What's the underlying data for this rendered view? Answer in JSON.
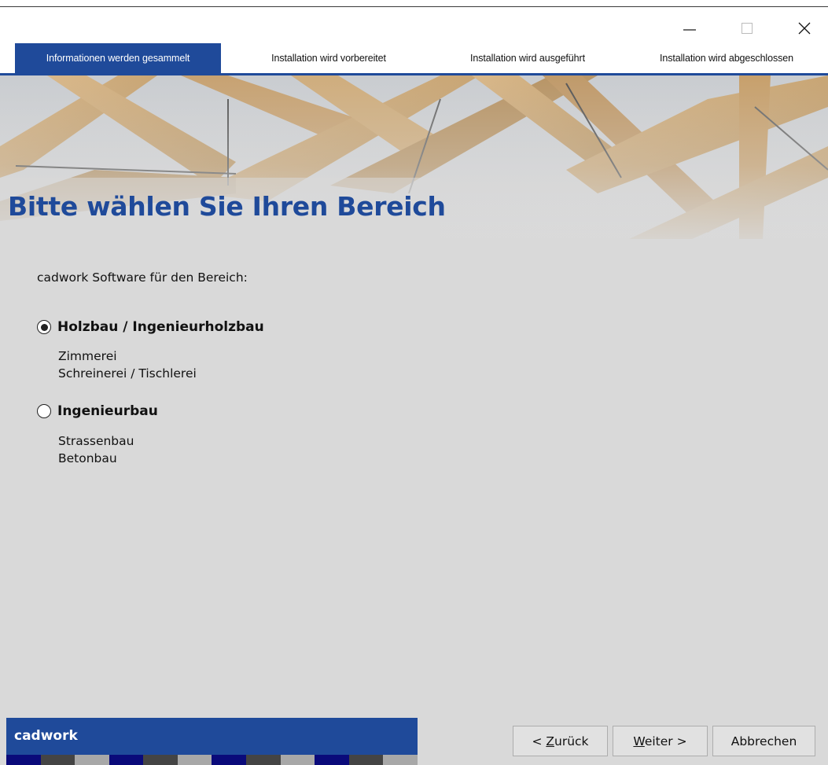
{
  "window": {
    "controls": {
      "minimize_icon": "minimize-icon",
      "maximize_icon": "maximize-icon",
      "close_icon": "close-icon"
    }
  },
  "steps": [
    {
      "label": "Informationen werden gesammelt",
      "active": true
    },
    {
      "label": "Installation wird vorbereitet",
      "active": false
    },
    {
      "label": "Installation wird ausgeführt",
      "active": false
    },
    {
      "label": "Installation wird abgeschlossen",
      "active": false
    }
  ],
  "page": {
    "title": "Bitte wählen Sie Ihren Bereich",
    "intro": "cadwork Software für den Bereich:"
  },
  "options": [
    {
      "label": "Holzbau / Ingenieurholzbau",
      "selected": true,
      "details": [
        "Zimmerei",
        "Schreinerei / Tischlerei"
      ]
    },
    {
      "label": "Ingenieurbau",
      "selected": false,
      "details": [
        "Strassenbau",
        "Betonbau"
      ]
    }
  ],
  "footer": {
    "brand": "cadwork",
    "back_label": "< Zurück",
    "next_label": "Weiter >",
    "cancel_label": "Abbrechen"
  },
  "colors": {
    "accent": "#1f4a9a",
    "content_bg": "#d9d9d9",
    "stripe": [
      "#0a0a7a",
      "#444444",
      "#a8a8a8",
      "#0a0a7a",
      "#444444",
      "#a8a8a8",
      "#0a0a7a",
      "#444444",
      "#a8a8a8",
      "#0a0a7a",
      "#444444",
      "#a8a8a8"
    ]
  }
}
